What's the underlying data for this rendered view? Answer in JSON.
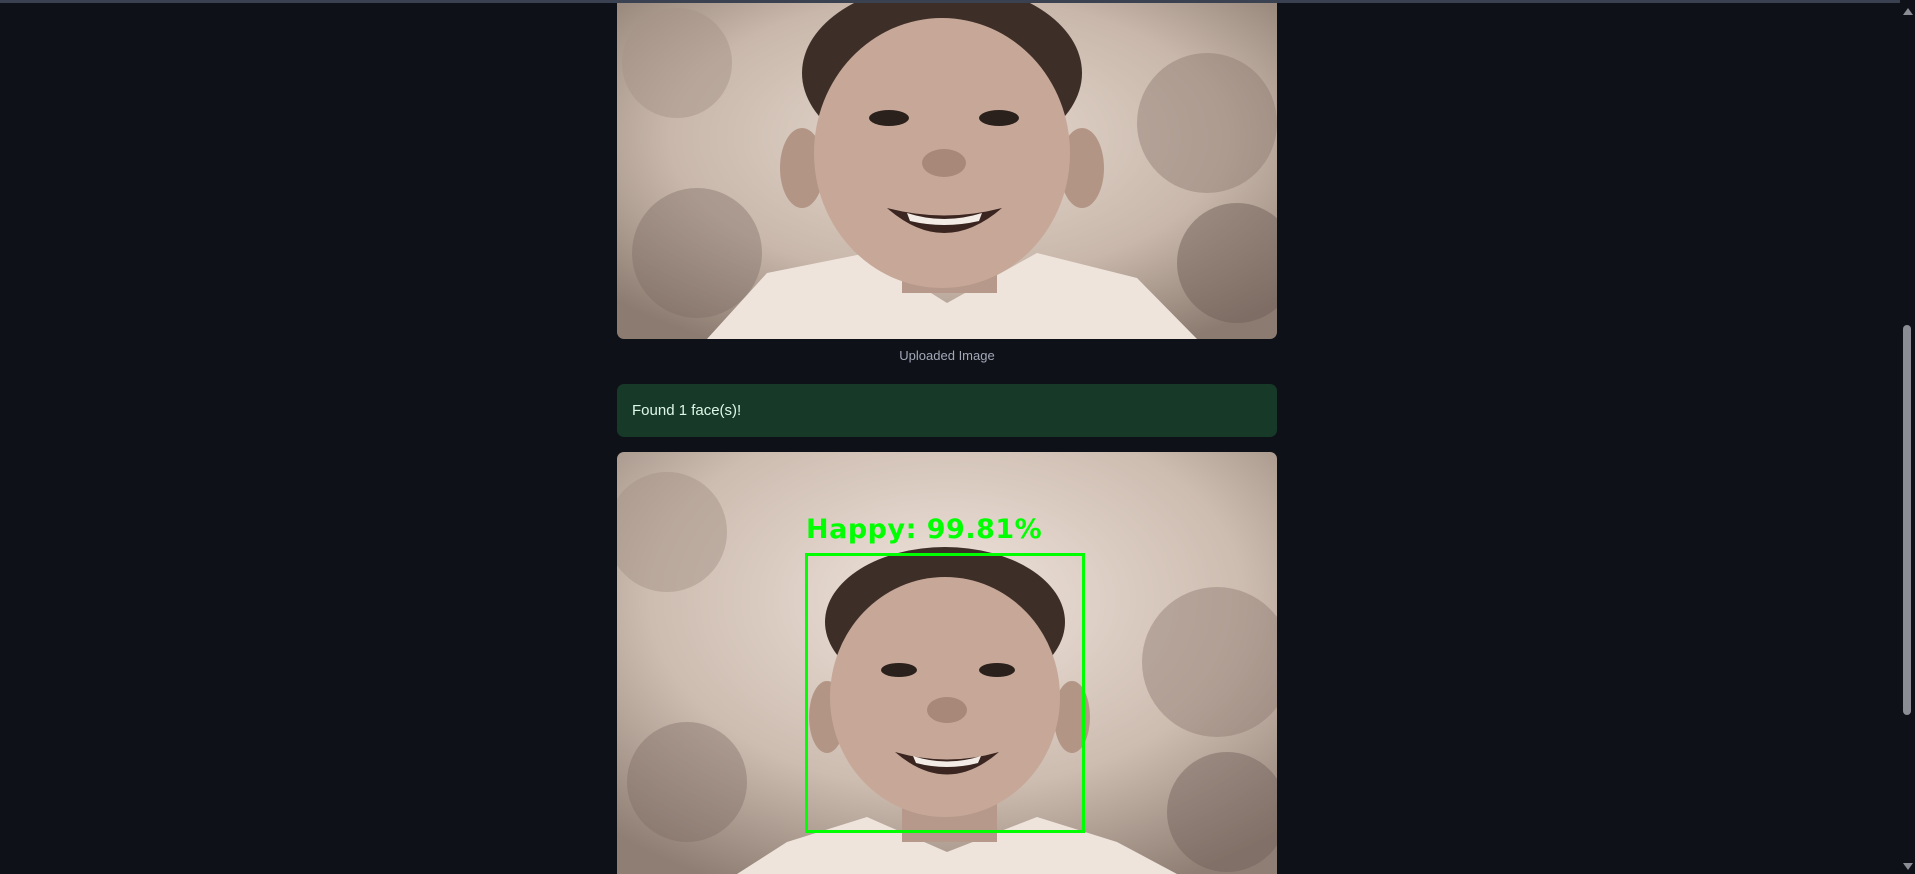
{
  "uploaded_image": {
    "alt": "Uploaded Image",
    "caption": "Uploaded Image"
  },
  "status_alert": {
    "text": "Found 1 face(s)!",
    "color": "#173928"
  },
  "result_image": {
    "alt": "Annotated result",
    "emotion_label": "Happy: 99.81%",
    "box_color": "#00ff00"
  },
  "theme": {
    "background": "#0e1117",
    "caption_color": "#a3a8b8"
  }
}
